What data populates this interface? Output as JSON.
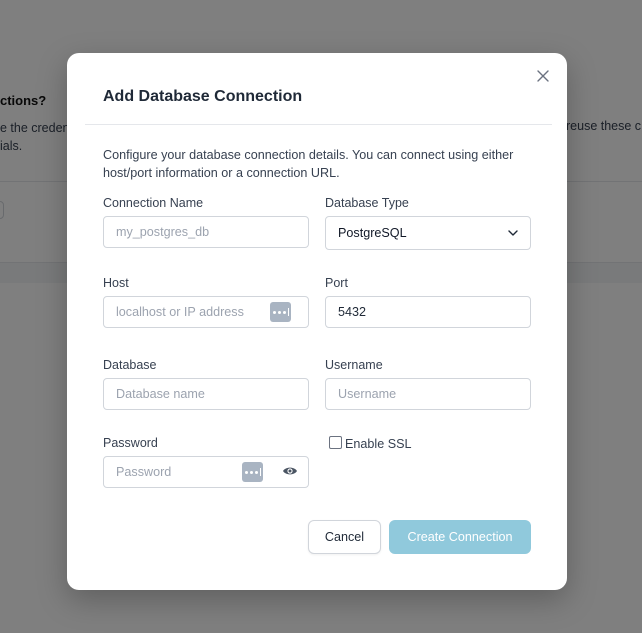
{
  "background": {
    "heading": "ctions?",
    "left_text": "e the creden\nials.",
    "right_text": "reuse these c"
  },
  "modal": {
    "title": "Add Database Connection",
    "description": "Configure your database connection details. You can connect using either host/port information or a connection URL.",
    "fields": {
      "connection_name": {
        "label": "Connection Name",
        "placeholder": "my_postgres_db",
        "value": ""
      },
      "database_type": {
        "label": "Database Type",
        "value": "PostgreSQL"
      },
      "host": {
        "label": "Host",
        "placeholder": "localhost or IP address",
        "value": ""
      },
      "port": {
        "label": "Port",
        "value": "5432"
      },
      "database": {
        "label": "Database",
        "placeholder": "Database name",
        "value": ""
      },
      "username": {
        "label": "Username",
        "placeholder": "Username",
        "value": ""
      },
      "password": {
        "label": "Password",
        "placeholder": "Password",
        "value": ""
      },
      "enable_ssl": {
        "label": "Enable SSL",
        "checked": false
      }
    },
    "buttons": {
      "cancel": "Cancel",
      "create": "Create Connection"
    }
  },
  "colors": {
    "primary_disabled": "#90c9dc",
    "overlay": "rgba(0,0,0,0.5)"
  },
  "icons": {
    "close": "close-icon",
    "select_chevron": "chevron-down-icon",
    "password_manager": "password-dots-icon",
    "show_password": "eye-icon"
  }
}
